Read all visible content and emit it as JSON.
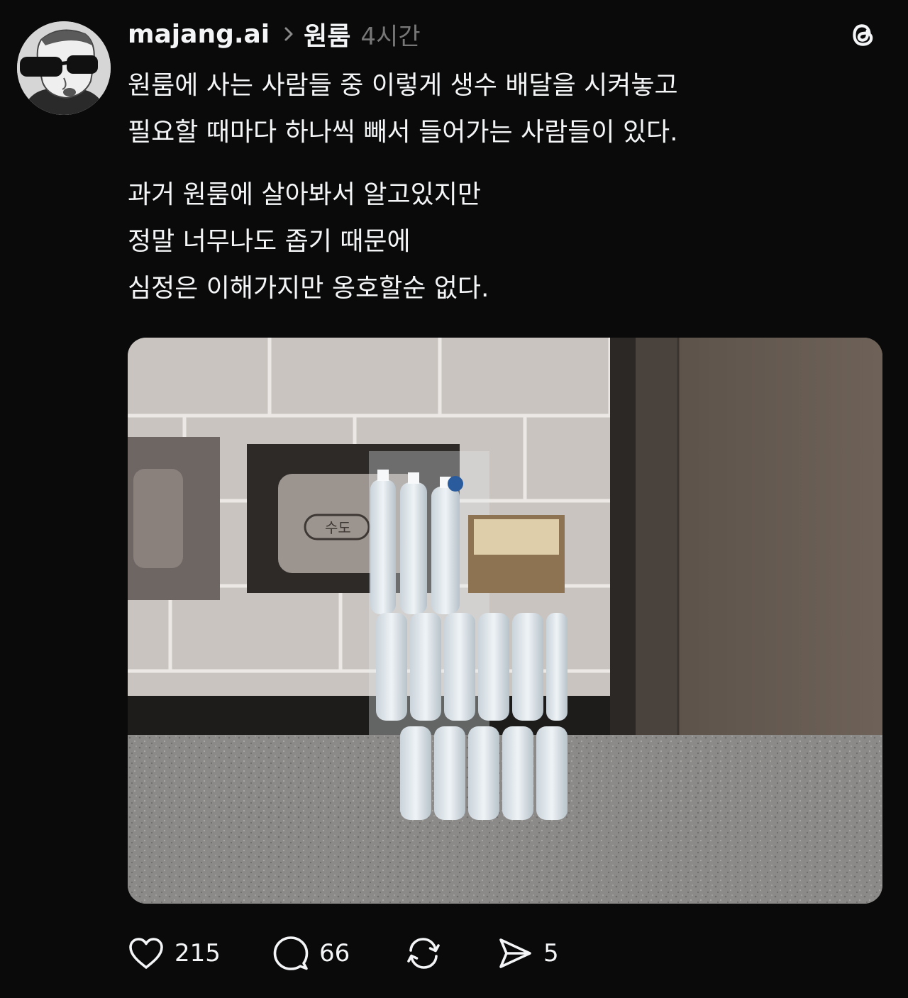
{
  "post": {
    "author": {
      "username": "majang.ai",
      "avatar_icon": "avatar-portrait-sunglasses-icon"
    },
    "topic": "원룸",
    "time": "4시간",
    "app_icon": "threads-logo-icon",
    "paragraphs": [
      {
        "lines": [
          "원룸에 사는 사람들 중 이렇게 생수 배달을 시켜놓고",
          "필요할 때마다 하나씩 빼서 들어가는 사람들이 있다."
        ]
      },
      {
        "lines": [
          "과거 원룸에 살아봐서 알고있지만",
          "정말 너무나도 좁기 때문에",
          "심정은 이해가지만 옹호할순 없다."
        ]
      }
    ],
    "image": {
      "panel_label": "수도"
    },
    "actions": {
      "likes": "215",
      "comments": "66",
      "reposts": "",
      "shares": "5"
    }
  },
  "colors": {
    "background": "#0a0a0a",
    "primary_text": "#f3f5f7",
    "secondary_text": "#777777"
  }
}
